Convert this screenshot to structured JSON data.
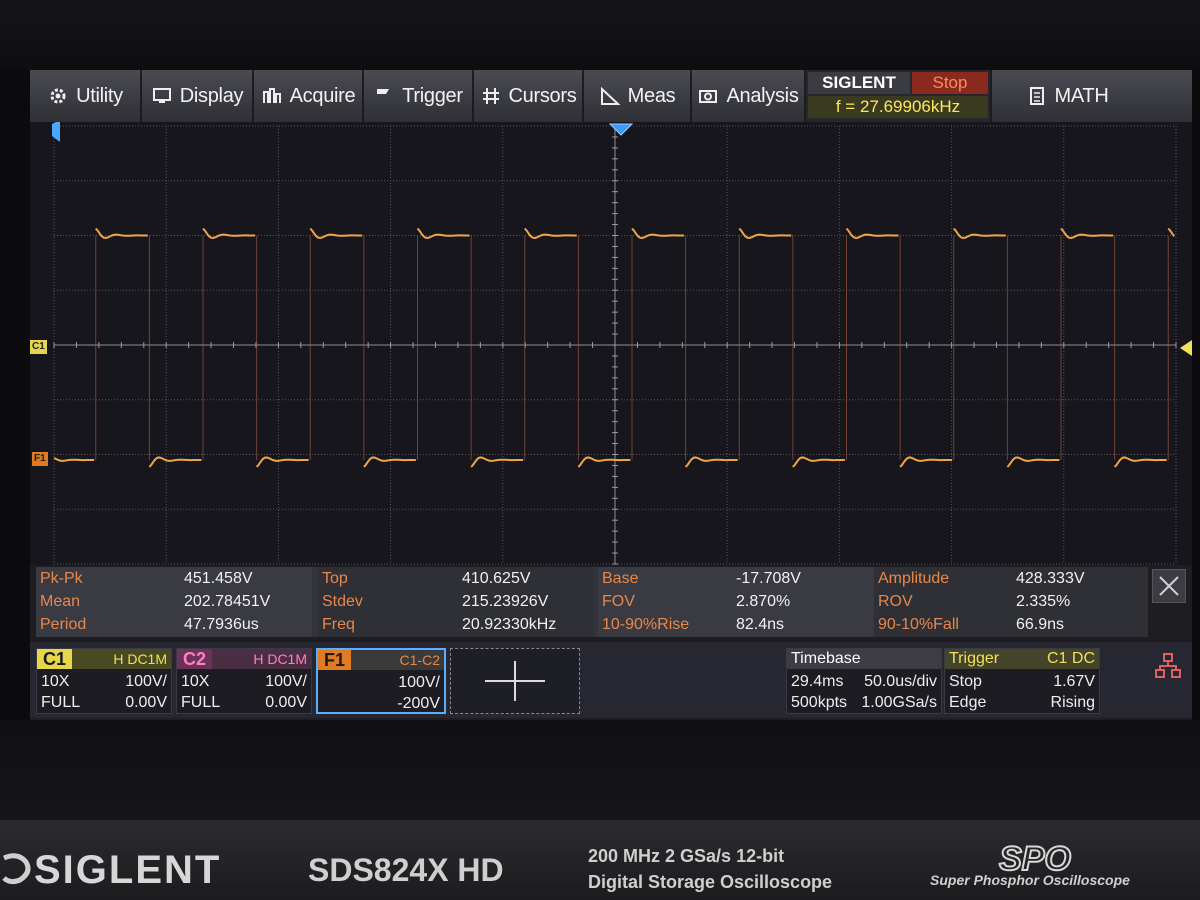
{
  "menu": {
    "utility": "Utility",
    "display": "Display",
    "acquire": "Acquire",
    "trigger": "Trigger",
    "cursors": "Cursors",
    "meas": "Meas",
    "analysis": "Analysis",
    "math": "MATH"
  },
  "status": {
    "brand": "SIGLENT",
    "run_state": "Stop",
    "frequency": "f = 27.69906kHz"
  },
  "markers": {
    "c1": "C1",
    "f1": "F1"
  },
  "measurements": [
    [
      {
        "name": "Pk-Pk",
        "value": "451.458V"
      },
      {
        "name": "Top",
        "value": "410.625V"
      },
      {
        "name": "Base",
        "value": "-17.708V"
      },
      {
        "name": "Amplitude",
        "value": "428.333V"
      }
    ],
    [
      {
        "name": "Mean",
        "value": "202.78451V"
      },
      {
        "name": "Stdev",
        "value": "215.23926V"
      },
      {
        "name": "FOV",
        "value": "2.870%"
      },
      {
        "name": "ROV",
        "value": "2.335%"
      }
    ],
    [
      {
        "name": "Period",
        "value": "47.7936us"
      },
      {
        "name": "Freq",
        "value": "20.92330kHz"
      },
      {
        "name": "10-90%Rise",
        "value": "82.4ns"
      },
      {
        "name": "90-10%Fall",
        "value": "66.9ns"
      }
    ]
  ],
  "channels": {
    "c1": {
      "name": "C1",
      "coupling": "H DC1M",
      "probe": "10X",
      "scale": "100V/",
      "bw": "FULL",
      "offset": "0.00V"
    },
    "c2": {
      "name": "C2",
      "coupling": "H DC1M",
      "probe": "10X",
      "scale": "100V/",
      "bw": "FULL",
      "offset": "0.00V"
    },
    "f1": {
      "name": "F1",
      "source": "C1-C2",
      "scale": "100V/",
      "offset": "-200V"
    }
  },
  "timebase": {
    "title": "Timebase",
    "delay": "29.4ms",
    "scale": "50.0us/div",
    "memory": "500kpts",
    "sample_rate": "1.00GSa/s"
  },
  "trigger": {
    "title": "Trigger",
    "source": "C1 DC",
    "mode": "Stop",
    "level": "1.67V",
    "type": "Edge",
    "slope": "Rising"
  },
  "bezel": {
    "brand": "SIGLENT",
    "model": "SDS824X HD",
    "spec_line1": "200 MHz  2 GSa/s  12-bit",
    "spec_line2": "Digital Storage Oscilloscope",
    "spo": "SPO",
    "spo_sub": "Super Phosphor Oscilloscope"
  },
  "colors": {
    "trace": "#f0a54a",
    "c1": "#e5d64a",
    "c2": "#ff7fc0",
    "f1": "#e07b24",
    "stop": "#ff8a5c",
    "freq": "#ffe65a"
  },
  "waveform": {
    "period_div": 0.9559,
    "phase_div": 0.85,
    "high_div": 2.0,
    "low_div": -2.1
  }
}
